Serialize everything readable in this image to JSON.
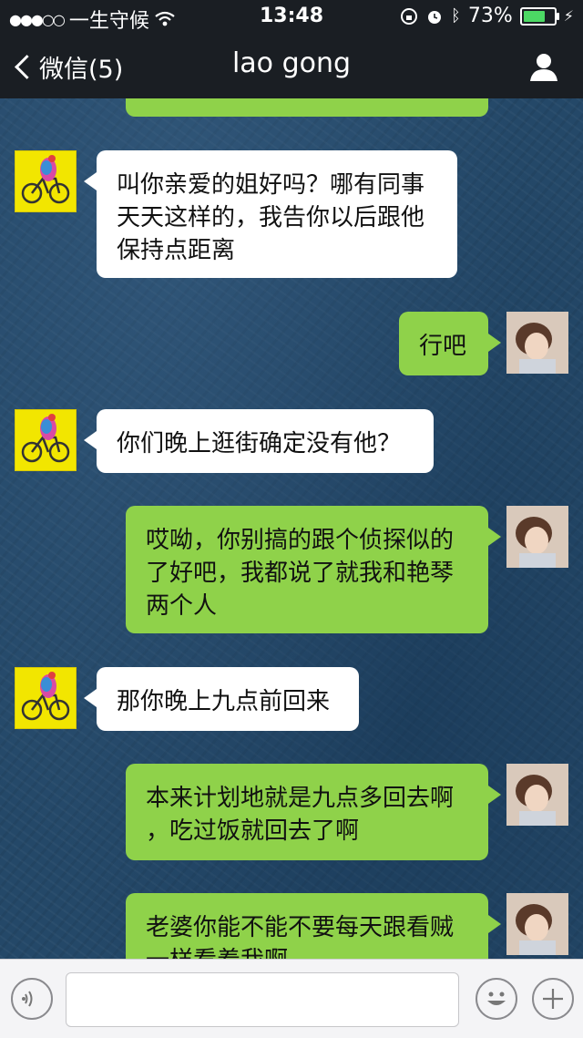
{
  "status_bar": {
    "carrier": "一生守候",
    "time": "13:48",
    "battery_percent": "73%",
    "battery_level": 0.73
  },
  "header": {
    "back_label": "微信(5)",
    "title": "lao gong"
  },
  "messages": [
    {
      "side": "in",
      "text": "叫你亲爱的姐好吗？哪有同事\n天天这样的，我告你以后跟他\n保持点距离"
    },
    {
      "side": "out",
      "text": "行吧"
    },
    {
      "side": "in",
      "text": "你们晚上逛街确定没有他？"
    },
    {
      "side": "out",
      "text": "哎呦，你别搞的跟个侦探似的\n了好吧，我都说了就我和艳琴\n两个人"
    },
    {
      "side": "in",
      "text": "那你晚上九点前回来"
    },
    {
      "side": "out",
      "text": "本来计划地就是九点多回去啊\n，吃过饭就回去了啊"
    },
    {
      "side": "out",
      "text": "老婆你能不能不要每天跟看贼\n一样看着我啊"
    }
  ],
  "input": {
    "placeholder": ""
  }
}
